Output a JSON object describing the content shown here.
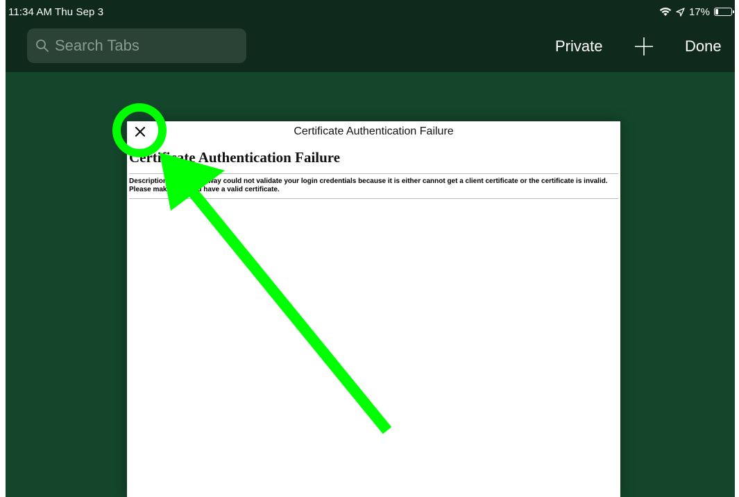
{
  "status_bar": {
    "time_date": "11:34 AM   Thu Sep 3",
    "battery_text": "17%",
    "battery_level": 0.17,
    "icons": [
      "wifi-icon",
      "location-arrow-icon",
      "battery-icon"
    ]
  },
  "toolbar": {
    "search_placeholder": "Search Tabs",
    "private_label": "Private",
    "add_icon": "plus-icon",
    "done_label": "Done"
  },
  "tab": {
    "title": "Certificate Authentication Failure",
    "close_icon": "close-x-icon",
    "page": {
      "heading": "Certificate Authentication Failure",
      "description": "Description: Client Gateway could not validate your login credentials because it is either cannot get a client certificate or the certificate is invalid. Please make sure you have a valid certificate."
    }
  },
  "annotation": {
    "color": "#00ff00",
    "shapes": [
      "highlight-circle",
      "pointer-arrow"
    ]
  },
  "colors": {
    "background": "#14462b",
    "toolbar": "#0f2a1d",
    "search_field": "#2b4337"
  }
}
